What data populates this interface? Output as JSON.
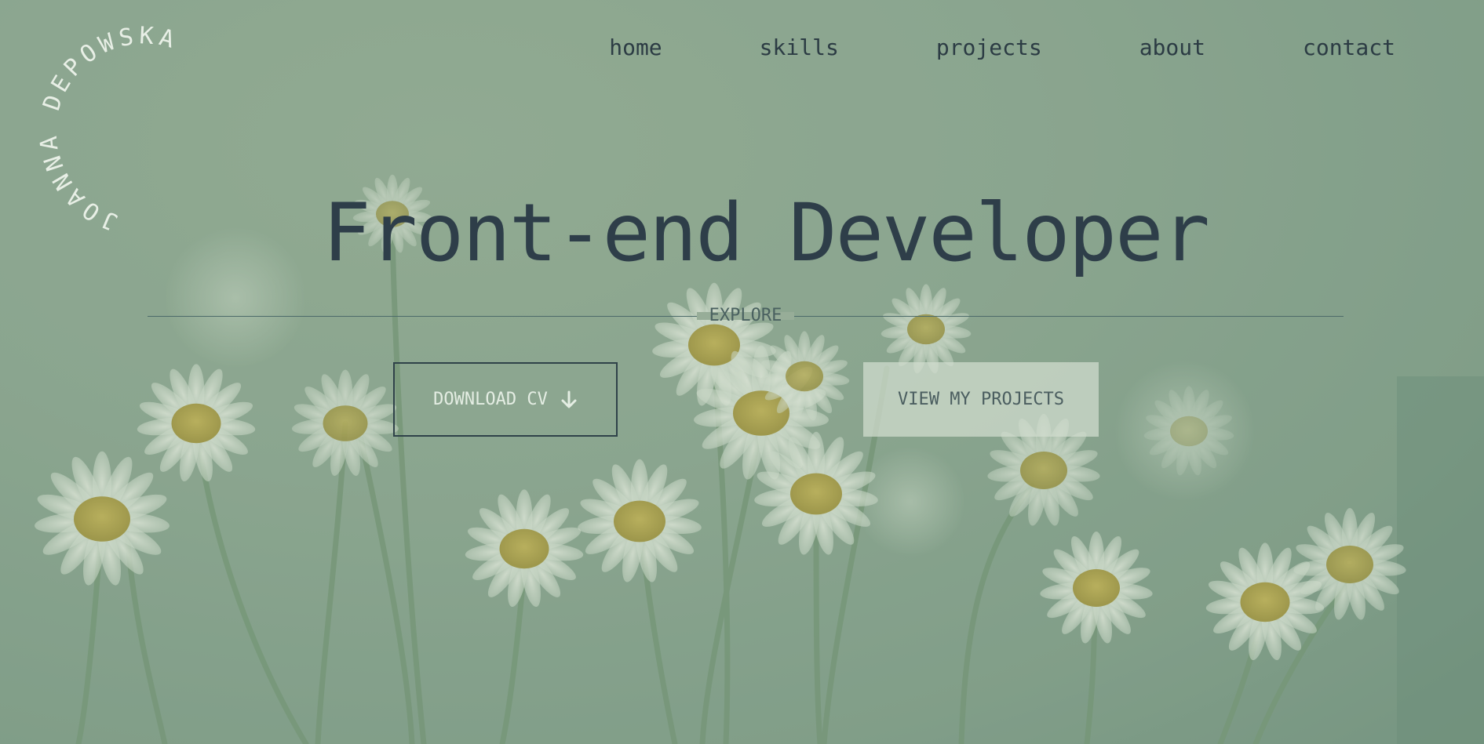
{
  "brand": {
    "name": "JOANNA DEPOWSKA"
  },
  "nav": {
    "items": [
      {
        "label": "home"
      },
      {
        "label": "skills"
      },
      {
        "label": "projects"
      },
      {
        "label": "about"
      },
      {
        "label": "contact"
      }
    ]
  },
  "hero": {
    "title": "Front-end Developer",
    "explore_label": "EXPLORE",
    "download_cv_label": "DOWNLOAD CV",
    "view_projects_label": "VIEW MY PROJECTS"
  },
  "icons": {
    "download": "arrow-down-icon",
    "background": "daisies-background"
  },
  "colors": {
    "background": "#8aa48f",
    "text_dark": "#2e3e49",
    "text_light": "#e4ede3",
    "button_light": "#d2ded0"
  }
}
